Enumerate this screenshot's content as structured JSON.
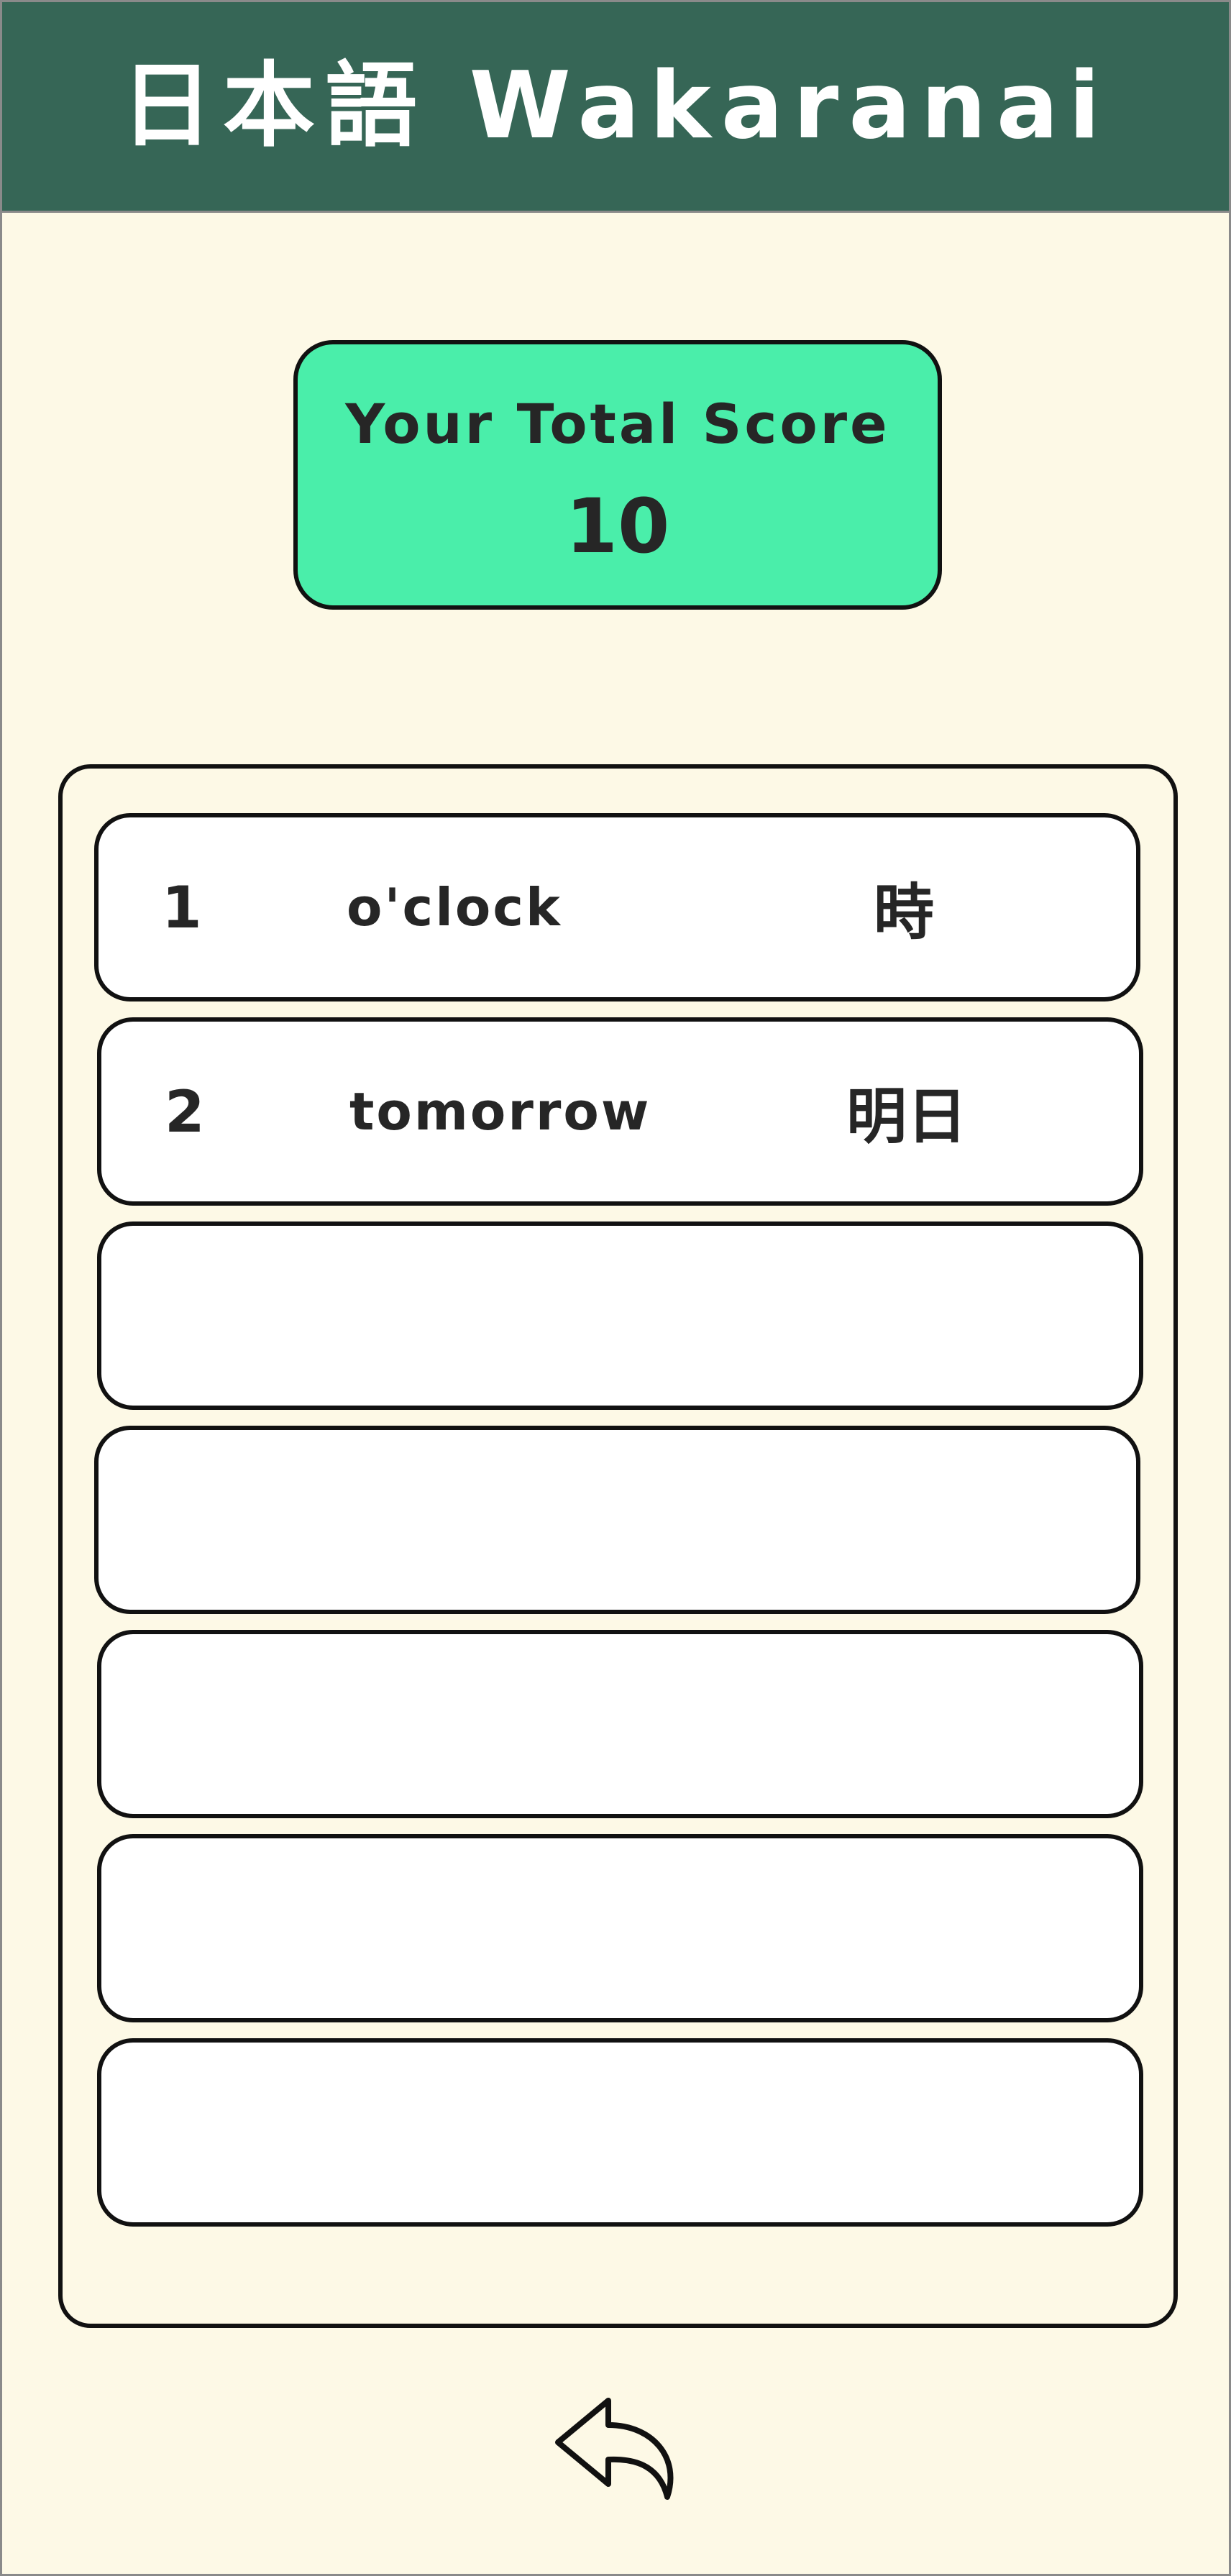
{
  "header": {
    "title": "日本語 Wakaranai"
  },
  "score": {
    "label": "Your Total Score",
    "value": "10"
  },
  "words": [
    {
      "num": "1",
      "english": "o'clock",
      "japanese": "時"
    },
    {
      "num": "2",
      "english": "tomorrow",
      "japanese": "明日"
    },
    {
      "num": "",
      "english": "",
      "japanese": ""
    },
    {
      "num": "",
      "english": "",
      "japanese": ""
    },
    {
      "num": "",
      "english": "",
      "japanese": ""
    },
    {
      "num": "",
      "english": "",
      "japanese": ""
    },
    {
      "num": "",
      "english": "",
      "japanese": ""
    }
  ],
  "back": {
    "icon": "back-arrow-icon"
  },
  "colors": {
    "header_bg": "#366656",
    "page_bg": "#fdf9e6",
    "score_bg": "#4aeeaa",
    "row_bg": "#ffffff",
    "outline": "#111111"
  }
}
